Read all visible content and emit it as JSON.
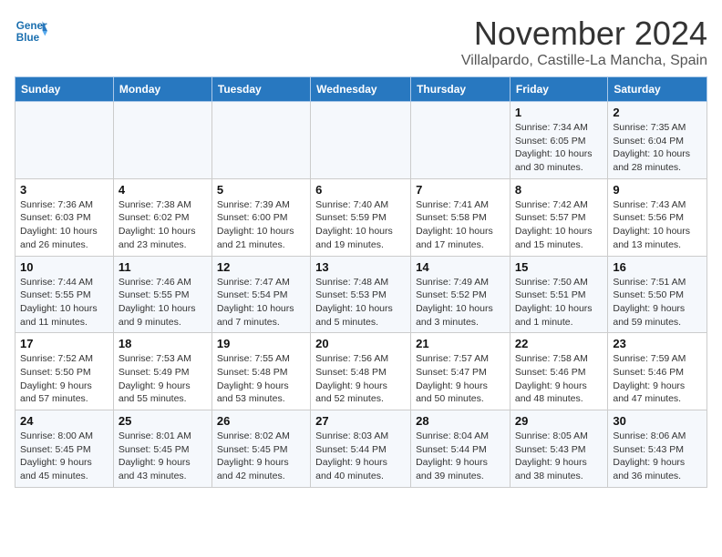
{
  "header": {
    "logo_line1": "General",
    "logo_line2": "Blue",
    "month": "November 2024",
    "location": "Villalpardo, Castille-La Mancha, Spain"
  },
  "weekdays": [
    "Sunday",
    "Monday",
    "Tuesday",
    "Wednesday",
    "Thursday",
    "Friday",
    "Saturday"
  ],
  "weeks": [
    [
      {
        "day": "",
        "info": ""
      },
      {
        "day": "",
        "info": ""
      },
      {
        "day": "",
        "info": ""
      },
      {
        "day": "",
        "info": ""
      },
      {
        "day": "",
        "info": ""
      },
      {
        "day": "1",
        "info": "Sunrise: 7:34 AM\nSunset: 6:05 PM\nDaylight: 10 hours and 30 minutes."
      },
      {
        "day": "2",
        "info": "Sunrise: 7:35 AM\nSunset: 6:04 PM\nDaylight: 10 hours and 28 minutes."
      }
    ],
    [
      {
        "day": "3",
        "info": "Sunrise: 7:36 AM\nSunset: 6:03 PM\nDaylight: 10 hours and 26 minutes."
      },
      {
        "day": "4",
        "info": "Sunrise: 7:38 AM\nSunset: 6:02 PM\nDaylight: 10 hours and 23 minutes."
      },
      {
        "day": "5",
        "info": "Sunrise: 7:39 AM\nSunset: 6:00 PM\nDaylight: 10 hours and 21 minutes."
      },
      {
        "day": "6",
        "info": "Sunrise: 7:40 AM\nSunset: 5:59 PM\nDaylight: 10 hours and 19 minutes."
      },
      {
        "day": "7",
        "info": "Sunrise: 7:41 AM\nSunset: 5:58 PM\nDaylight: 10 hours and 17 minutes."
      },
      {
        "day": "8",
        "info": "Sunrise: 7:42 AM\nSunset: 5:57 PM\nDaylight: 10 hours and 15 minutes."
      },
      {
        "day": "9",
        "info": "Sunrise: 7:43 AM\nSunset: 5:56 PM\nDaylight: 10 hours and 13 minutes."
      }
    ],
    [
      {
        "day": "10",
        "info": "Sunrise: 7:44 AM\nSunset: 5:55 PM\nDaylight: 10 hours and 11 minutes."
      },
      {
        "day": "11",
        "info": "Sunrise: 7:46 AM\nSunset: 5:55 PM\nDaylight: 10 hours and 9 minutes."
      },
      {
        "day": "12",
        "info": "Sunrise: 7:47 AM\nSunset: 5:54 PM\nDaylight: 10 hours and 7 minutes."
      },
      {
        "day": "13",
        "info": "Sunrise: 7:48 AM\nSunset: 5:53 PM\nDaylight: 10 hours and 5 minutes."
      },
      {
        "day": "14",
        "info": "Sunrise: 7:49 AM\nSunset: 5:52 PM\nDaylight: 10 hours and 3 minutes."
      },
      {
        "day": "15",
        "info": "Sunrise: 7:50 AM\nSunset: 5:51 PM\nDaylight: 10 hours and 1 minute."
      },
      {
        "day": "16",
        "info": "Sunrise: 7:51 AM\nSunset: 5:50 PM\nDaylight: 9 hours and 59 minutes."
      }
    ],
    [
      {
        "day": "17",
        "info": "Sunrise: 7:52 AM\nSunset: 5:50 PM\nDaylight: 9 hours and 57 minutes."
      },
      {
        "day": "18",
        "info": "Sunrise: 7:53 AM\nSunset: 5:49 PM\nDaylight: 9 hours and 55 minutes."
      },
      {
        "day": "19",
        "info": "Sunrise: 7:55 AM\nSunset: 5:48 PM\nDaylight: 9 hours and 53 minutes."
      },
      {
        "day": "20",
        "info": "Sunrise: 7:56 AM\nSunset: 5:48 PM\nDaylight: 9 hours and 52 minutes."
      },
      {
        "day": "21",
        "info": "Sunrise: 7:57 AM\nSunset: 5:47 PM\nDaylight: 9 hours and 50 minutes."
      },
      {
        "day": "22",
        "info": "Sunrise: 7:58 AM\nSunset: 5:46 PM\nDaylight: 9 hours and 48 minutes."
      },
      {
        "day": "23",
        "info": "Sunrise: 7:59 AM\nSunset: 5:46 PM\nDaylight: 9 hours and 47 minutes."
      }
    ],
    [
      {
        "day": "24",
        "info": "Sunrise: 8:00 AM\nSunset: 5:45 PM\nDaylight: 9 hours and 45 minutes."
      },
      {
        "day": "25",
        "info": "Sunrise: 8:01 AM\nSunset: 5:45 PM\nDaylight: 9 hours and 43 minutes."
      },
      {
        "day": "26",
        "info": "Sunrise: 8:02 AM\nSunset: 5:45 PM\nDaylight: 9 hours and 42 minutes."
      },
      {
        "day": "27",
        "info": "Sunrise: 8:03 AM\nSunset: 5:44 PM\nDaylight: 9 hours and 40 minutes."
      },
      {
        "day": "28",
        "info": "Sunrise: 8:04 AM\nSunset: 5:44 PM\nDaylight: 9 hours and 39 minutes."
      },
      {
        "day": "29",
        "info": "Sunrise: 8:05 AM\nSunset: 5:43 PM\nDaylight: 9 hours and 38 minutes."
      },
      {
        "day": "30",
        "info": "Sunrise: 8:06 AM\nSunset: 5:43 PM\nDaylight: 9 hours and 36 minutes."
      }
    ]
  ]
}
